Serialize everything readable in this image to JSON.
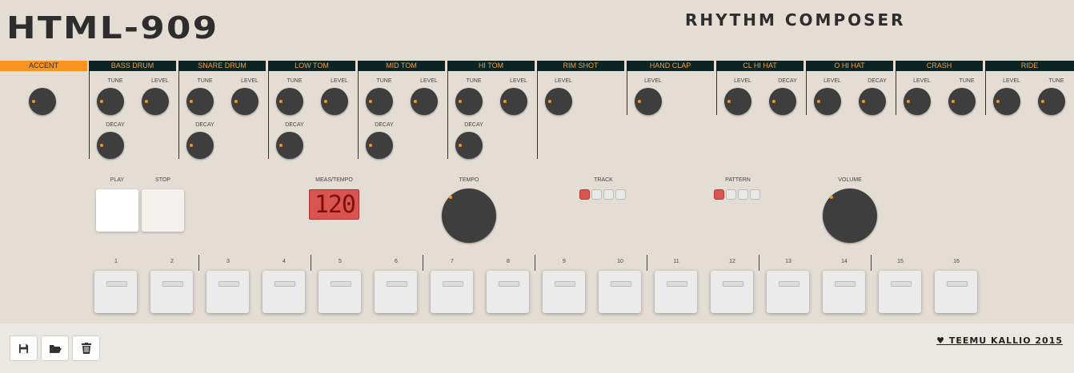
{
  "app": {
    "title": "HTML-909",
    "subtitle": "RHYTHM COMPOSER"
  },
  "instruments": [
    {
      "id": "accent",
      "label": "ACCENT",
      "knobs": [
        {
          "label": ""
        }
      ]
    },
    {
      "id": "bass-drum",
      "label": "BASS DRUM",
      "knobs": [
        {
          "label": "TUNE"
        },
        {
          "label": "LEVEL"
        },
        {
          "label": "DECAY"
        }
      ]
    },
    {
      "id": "snare-drum",
      "label": "SNARE DRUM",
      "knobs": [
        {
          "label": "TUNE"
        },
        {
          "label": "LEVEL"
        },
        {
          "label": "DECAY"
        }
      ]
    },
    {
      "id": "low-tom",
      "label": "LOW TOM",
      "knobs": [
        {
          "label": "TUNE"
        },
        {
          "label": "LEVEL"
        },
        {
          "label": "DECAY"
        }
      ]
    },
    {
      "id": "mid-tom",
      "label": "MID TOM",
      "knobs": [
        {
          "label": "TUNE"
        },
        {
          "label": "LEVEL"
        },
        {
          "label": "DECAY"
        }
      ]
    },
    {
      "id": "hi-tom",
      "label": "HI TOM",
      "knobs": [
        {
          "label": "TUNE"
        },
        {
          "label": "LEVEL"
        },
        {
          "label": "DECAY"
        }
      ]
    },
    {
      "id": "rim-shot",
      "label": "RIM SHOT",
      "knobs": [
        {
          "label": "LEVEL"
        }
      ]
    },
    {
      "id": "hand-clap",
      "label": "HAND CLAP",
      "knobs": [
        {
          "label": "LEVEL"
        }
      ]
    },
    {
      "id": "cl-hi-hat",
      "label": "CL HI HAT",
      "knobs": [
        {
          "label": "LEVEL"
        },
        {
          "label": "DECAY"
        }
      ]
    },
    {
      "id": "o-hi-hat",
      "label": "O HI HAT",
      "knobs": [
        {
          "label": "LEVEL"
        },
        {
          "label": "DECAY"
        }
      ]
    },
    {
      "id": "crash",
      "label": "CRASH",
      "knobs": [
        {
          "label": "LEVEL"
        },
        {
          "label": "TUNE"
        }
      ]
    },
    {
      "id": "ride",
      "label": "RIDE",
      "knobs": [
        {
          "label": "LEVEL"
        },
        {
          "label": "TUNE"
        }
      ]
    }
  ],
  "transport": {
    "play_label": "PLAY",
    "stop_label": "STOP"
  },
  "display": {
    "label": "MEAS/TEMPO",
    "value": "120"
  },
  "tempo": {
    "label": "TEMPO"
  },
  "track": {
    "label": "TRACK",
    "active": 1,
    "count": 4
  },
  "pattern": {
    "label": "PATTERN",
    "active": 1,
    "count": 4
  },
  "volume": {
    "label": "VOLUME"
  },
  "steps": [
    "1",
    "2",
    "3",
    "4",
    "5",
    "6",
    "7",
    "8",
    "9",
    "10",
    "11",
    "12",
    "13",
    "14",
    "15",
    "16"
  ],
  "footer": {
    "credit": "♥ TEEMU KALLIO 2015",
    "buttons": [
      "save-icon",
      "open-folder-icon",
      "trash-icon"
    ]
  },
  "colors": {
    "accent": "#f7931e",
    "header_bg": "#0d2424",
    "led_on": "#d9534f",
    "panel": "#e3ddd4",
    "knob": "#3e3e3e"
  }
}
